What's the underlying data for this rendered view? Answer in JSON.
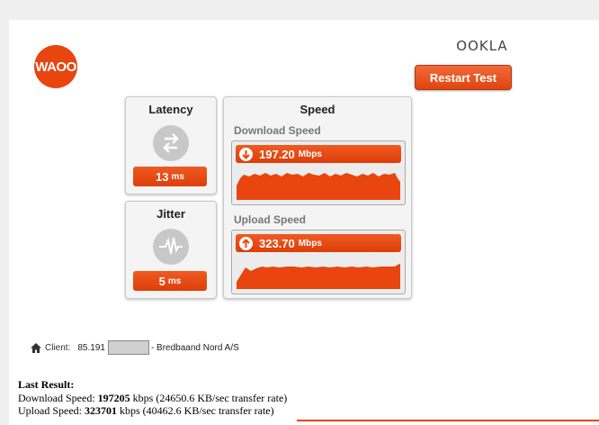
{
  "header": {
    "logo_text": "WAOO",
    "brand": "OOKLA",
    "restart_label": "Restart Test"
  },
  "latency": {
    "title": "Latency",
    "value": "13",
    "unit": "ms"
  },
  "jitter": {
    "title": "Jitter",
    "value": "5",
    "unit": "ms"
  },
  "speed": {
    "title": "Speed",
    "download": {
      "label": "Download Speed",
      "value": "197.20",
      "unit": "Mbps"
    },
    "upload": {
      "label": "Upload Speed",
      "value": "323.70",
      "unit": "Mbps"
    }
  },
  "client": {
    "label": "Client:",
    "ip_prefix": "85.191",
    "isp": "- Bredbaand Nord A/S"
  },
  "result": {
    "heading": "Last Result:",
    "download_prefix": "Download Speed: ",
    "download_kbps": "197205",
    "download_suffix": " kbps (24650.6 KB/sec transfer rate)",
    "upload_prefix": "Upload Speed: ",
    "upload_kbps": "323701",
    "upload_suffix": " kbps (40462.6 KB/sec transfer rate)"
  },
  "colors": {
    "accent": "#e8450f",
    "panel": "#f4f4f4",
    "icon_gray": "#c8c8c8"
  }
}
